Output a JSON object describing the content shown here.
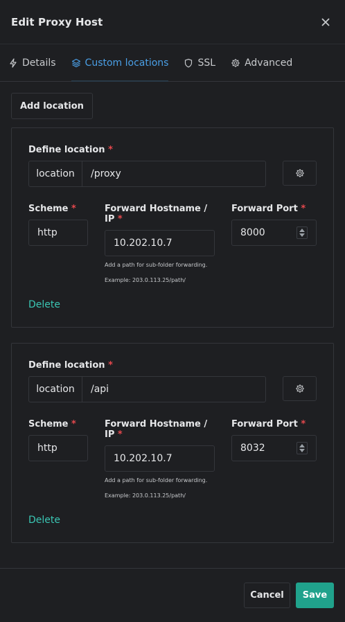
{
  "header": {
    "title": "Edit Proxy Host",
    "close_icon": "close-icon"
  },
  "tabs": [
    {
      "label": "Details",
      "icon": "bolt-icon"
    },
    {
      "label": "Custom locations",
      "icon": "layers-icon",
      "active": true
    },
    {
      "label": "SSL",
      "icon": "shield-icon"
    },
    {
      "label": "Advanced",
      "icon": "gear-icon"
    }
  ],
  "actions": {
    "add_location": "Add location"
  },
  "locations": [
    {
      "define_label": "Define location",
      "addon": "location",
      "path": "/proxy",
      "scheme_label": "Scheme",
      "scheme": "http",
      "host_label": "Forward Hostname / IP",
      "host": "10.202.10.7",
      "hint1": "Add a path for sub-folder forwarding.",
      "hint2": "Example: 203.0.113.25/path/",
      "port_label": "Forward Port",
      "port": "8000",
      "delete": "Delete"
    },
    {
      "define_label": "Define location",
      "addon": "location",
      "path": "/api",
      "scheme_label": "Scheme",
      "scheme": "http",
      "host_label": "Forward Hostname / IP",
      "host": "10.202.10.7",
      "hint1": "Add a path for sub-folder forwarding.",
      "hint2": "Example: 203.0.113.25/path/",
      "port_label": "Forward Port",
      "port": "8032",
      "delete": "Delete"
    }
  ],
  "footer": {
    "cancel": "Cancel",
    "save": "Save"
  },
  "colors": {
    "accent": "#20a28c",
    "link": "#3ac6b4",
    "tab_active": "#4a9fe6",
    "required": "#e5484d"
  }
}
